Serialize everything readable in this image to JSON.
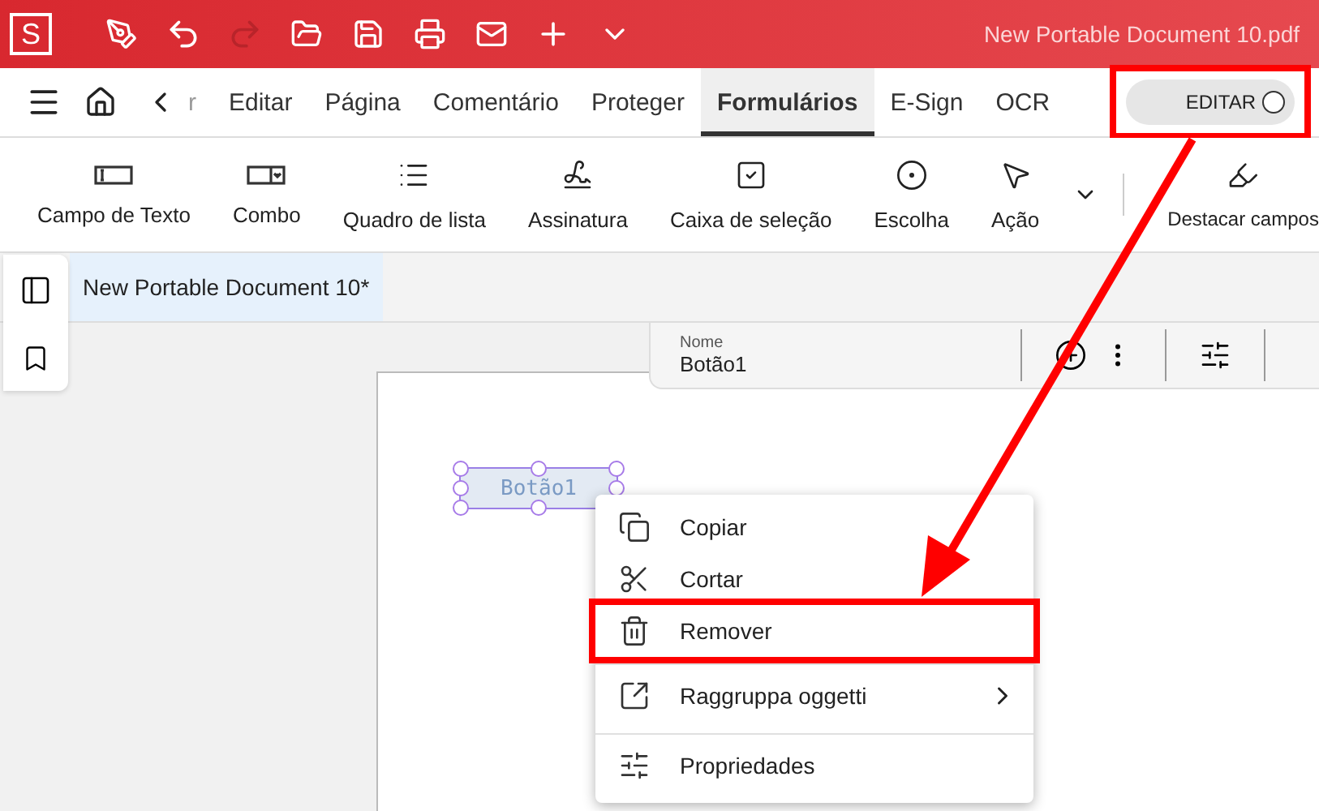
{
  "title_bar": {
    "app_logo": "S",
    "document_title": "New Portable Document 10.pdf"
  },
  "menu_bar": {
    "cut_label": "r",
    "tabs": [
      {
        "label": "Editar",
        "selected": false
      },
      {
        "label": "Página",
        "selected": false
      },
      {
        "label": "Comentário",
        "selected": false
      },
      {
        "label": "Proteger",
        "selected": false
      },
      {
        "label": "Formulários",
        "selected": true
      },
      {
        "label": "E-Sign",
        "selected": false
      },
      {
        "label": "OCR",
        "selected": false
      }
    ],
    "edit_toggle": {
      "label": "EDITAR",
      "on": false,
      "annotated": true
    }
  },
  "ribbon": {
    "tools": [
      {
        "label": "Campo de Texto",
        "kind": "textfield"
      },
      {
        "label": "Combo",
        "kind": "combo"
      },
      {
        "label": "Quadro de lista",
        "kind": "list"
      },
      {
        "label": "Assinatura",
        "kind": "signature"
      },
      {
        "label": "Caixa de seleção",
        "kind": "checkbox"
      },
      {
        "label": "Escolha",
        "kind": "radio"
      },
      {
        "label": "Ação",
        "kind": "action"
      }
    ],
    "extra_tool": {
      "label": "Destacar campos"
    }
  },
  "document_tab": {
    "label": "New Portable Document 10*",
    "selected": true
  },
  "properties_bar": {
    "field_label": "Nome",
    "field_value": "Botão1"
  },
  "form_field": {
    "label": "Botão1",
    "selected": true
  },
  "context_menu": {
    "items": [
      {
        "label": "Copiar",
        "kind": "copy",
        "submenu": false,
        "divider_before": false,
        "annotated": false
      },
      {
        "label": "Cortar",
        "kind": "cut",
        "submenu": false,
        "divider_before": false,
        "annotated": false
      },
      {
        "label": "Remover",
        "kind": "delete",
        "submenu": false,
        "divider_before": false,
        "annotated": true
      },
      {
        "label": "Raggruppa oggetti",
        "kind": "group",
        "submenu": true,
        "divider_before": true,
        "annotated": false
      },
      {
        "label": "Propriedades",
        "kind": "properties",
        "submenu": false,
        "divider_before": true,
        "annotated": false
      }
    ]
  }
}
